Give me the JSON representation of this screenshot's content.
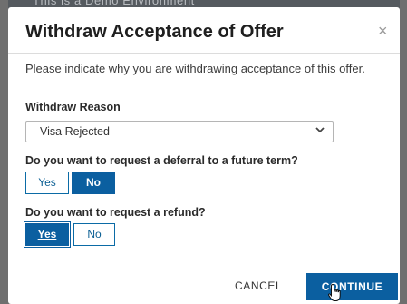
{
  "backdrop": {
    "heading_partial": "This is a Demo Environment"
  },
  "modal": {
    "title": "Withdraw Acceptance of Offer",
    "close_symbol": "×",
    "intro": "Please indicate why you are withdrawing acceptance of this offer.",
    "reason": {
      "label": "Withdraw Reason",
      "selected_value": "Visa Rejected",
      "icon": "chevron-down-icon"
    },
    "deferral": {
      "question": "Do you want to request a deferral to a future term?",
      "yes_label": "Yes",
      "no_label": "No",
      "selected": "No"
    },
    "refund": {
      "question": "Do you want to request a refund?",
      "yes_label": "Yes",
      "no_label": "No",
      "selected": "Yes"
    },
    "footer": {
      "cancel_label": "CANCEL",
      "continue_label": "CONTINUE"
    }
  },
  "colors": {
    "primary": "#0b5fa0",
    "backdrop": "#6f6f6f"
  },
  "cursor_icon": "hand-pointer-icon"
}
